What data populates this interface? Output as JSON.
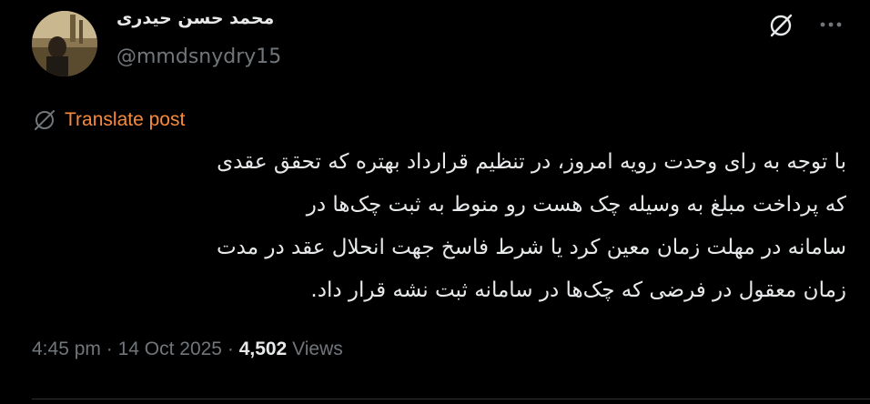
{
  "author": {
    "display_name": "محمد حسن حیدری",
    "handle": "@mmdsnydry15"
  },
  "header": {
    "grok_icon": "grok-slash-circle-icon",
    "more_icon": "more-horizontal-icon"
  },
  "translate": {
    "label": "Translate post",
    "icon": "translate-globe-slash-icon",
    "color": "#f98a3c"
  },
  "post": {
    "lines": [
      "با توجه به رای وحدت رویه امروز، در تنظیم قرارداد بهتره که تحقق عقدی",
      "که پرداخت مبلغ   به وسیله چک هست رو منوط به ثبت چک‌ها در",
      "سامانه در مهلت زمان معین کرد یا شرط فاسخ جهت انحلال عقد در مدت",
      "زمان معقول در فرضی که چک‌ها در سامانه ثبت نشه قرار داد."
    ]
  },
  "meta": {
    "time": "4:45 pm",
    "separator": "·",
    "date": "14 Oct 2025",
    "views_count": "4,502",
    "views_label": "Views"
  },
  "colors": {
    "background": "#000000",
    "text": "#e7e9ea",
    "muted": "#71767b",
    "accent": "#f98a3c"
  }
}
